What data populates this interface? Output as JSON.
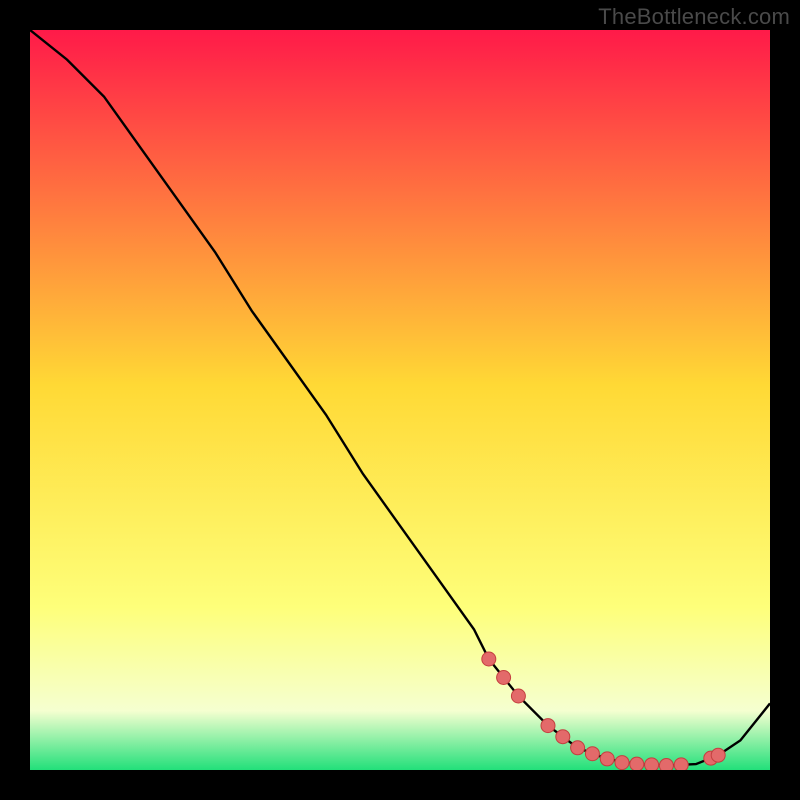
{
  "watermark": "TheBottleneck.com",
  "colors": {
    "bg_black": "#000000",
    "grad_top": "#ff1a49",
    "grad_mid": "#ffd935",
    "grad_yellow": "#feff7a",
    "grad_pale": "#f5ffd0",
    "grad_green": "#22e07a",
    "curve": "#000000",
    "dot_fill": "#e36a6a",
    "dot_stroke": "#c43f3f"
  },
  "chart_data": {
    "type": "line",
    "title": "",
    "xlabel": "",
    "ylabel": "",
    "xlim": [
      0,
      100
    ],
    "ylim": [
      0,
      100
    ],
    "grid": false,
    "legend": false,
    "series": [
      {
        "name": "bottleneck-curve",
        "x": [
          0,
          5,
          10,
          15,
          20,
          25,
          30,
          35,
          40,
          45,
          50,
          55,
          60,
          62,
          66,
          70,
          74,
          78,
          82,
          86,
          90,
          93,
          96,
          100
        ],
        "y": [
          100,
          96,
          91,
          84,
          77,
          70,
          62,
          55,
          48,
          40,
          33,
          26,
          19,
          15,
          10,
          6,
          3,
          1.5,
          0.8,
          0.6,
          0.8,
          2,
          4,
          9
        ]
      }
    ],
    "markers": {
      "name": "bottleneck-range-dots",
      "x": [
        62,
        64,
        66,
        70,
        72,
        74,
        76,
        78,
        80,
        82,
        84,
        86,
        88,
        92,
        93
      ],
      "y": [
        15,
        12.5,
        10,
        6,
        4.5,
        3,
        2.2,
        1.5,
        1.0,
        0.8,
        0.7,
        0.6,
        0.7,
        1.6,
        2.0
      ]
    }
  }
}
